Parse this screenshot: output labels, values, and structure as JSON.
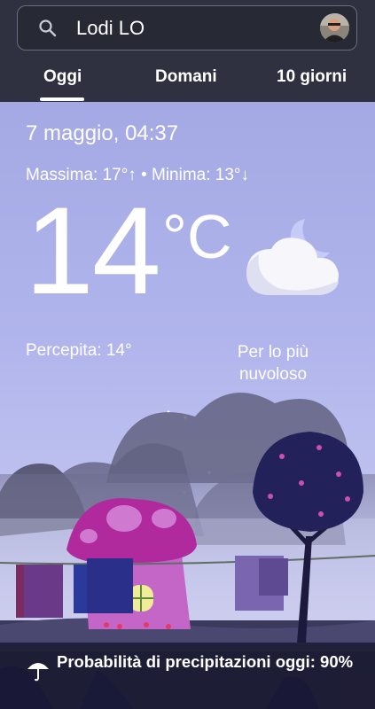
{
  "search": {
    "query": "Lodi LO",
    "icon": "search-icon"
  },
  "tabs": [
    {
      "label": "Oggi",
      "active": true
    },
    {
      "label": "Domani",
      "active": false
    },
    {
      "label": "10 giorni",
      "active": false
    }
  ],
  "weather": {
    "datetime": "7 maggio, 04:37",
    "minmax": "Massima: 17°↑ • Minima: 13°↓",
    "temperature": "14",
    "unit": "°C",
    "feels_like": "Percepita: 14°",
    "condition": "Per lo più nuvoloso",
    "condition_icon": "moon-cloud-icon"
  },
  "precipitation": {
    "text": "Probabilità di precipitazioni oggi: 90%",
    "icon": "umbrella-icon"
  },
  "colors": {
    "bar": "#2f3140",
    "sky_top": "#a4a9e4",
    "sky_bottom": "#d3d1f0",
    "mushroom_cap": "#b02a9e"
  }
}
